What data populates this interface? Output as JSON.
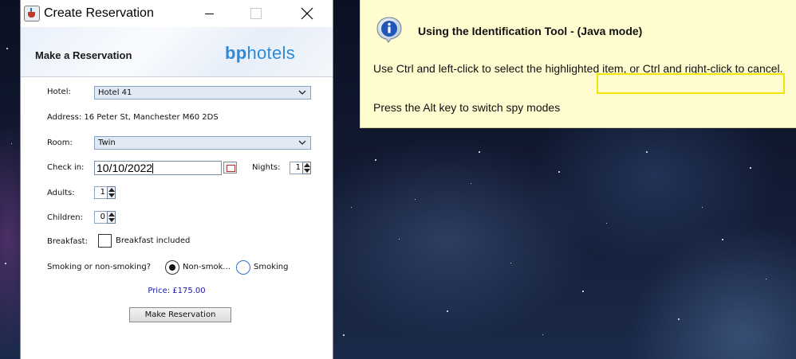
{
  "window": {
    "title": "Create Reservation",
    "icon": "java-cup-icon"
  },
  "banner": {
    "heading": "Make a Reservation",
    "logo_bold": "bp",
    "logo_rest": "hotels"
  },
  "form": {
    "hotel_label": "Hotel:",
    "hotel_value": "Hotel 41",
    "address_text": "Address: 16 Peter St, Manchester M60 2DS",
    "room_label": "Room:",
    "room_value": "Twin",
    "checkin_label": "Check in:",
    "checkin_value": "10/10/2022",
    "nights_label": "Nights:",
    "nights_value": "1",
    "adults_label": "Adults:",
    "adults_value": "1",
    "children_label": "Children:",
    "children_value": "0",
    "breakfast_label": "Breakfast:",
    "breakfast_checkbox_label": "Breakfast included",
    "breakfast_checked": false,
    "smoking_label": "Smoking or non-smoking?",
    "nonsmoking_option": "Non-smok...",
    "smoking_option": "Smoking",
    "selected_smoking_option": "Non-smok...",
    "price_text": "Price: £175.00",
    "submit_label": "Make Reservation"
  },
  "tooltip": {
    "title": "Using the Identification Tool - (Java mode)",
    "line1": "Use Ctrl and left-click to select the highlighted item, or Ctrl and right-click to cancel.",
    "line2": "Press the Alt key to switch spy modes",
    "icon": "info-icon"
  },
  "colors": {
    "tooltip_bg": "#fffdd0",
    "highlight": "#f2e600",
    "logo": "#2d8ad6",
    "price": "#1a1aa8"
  }
}
